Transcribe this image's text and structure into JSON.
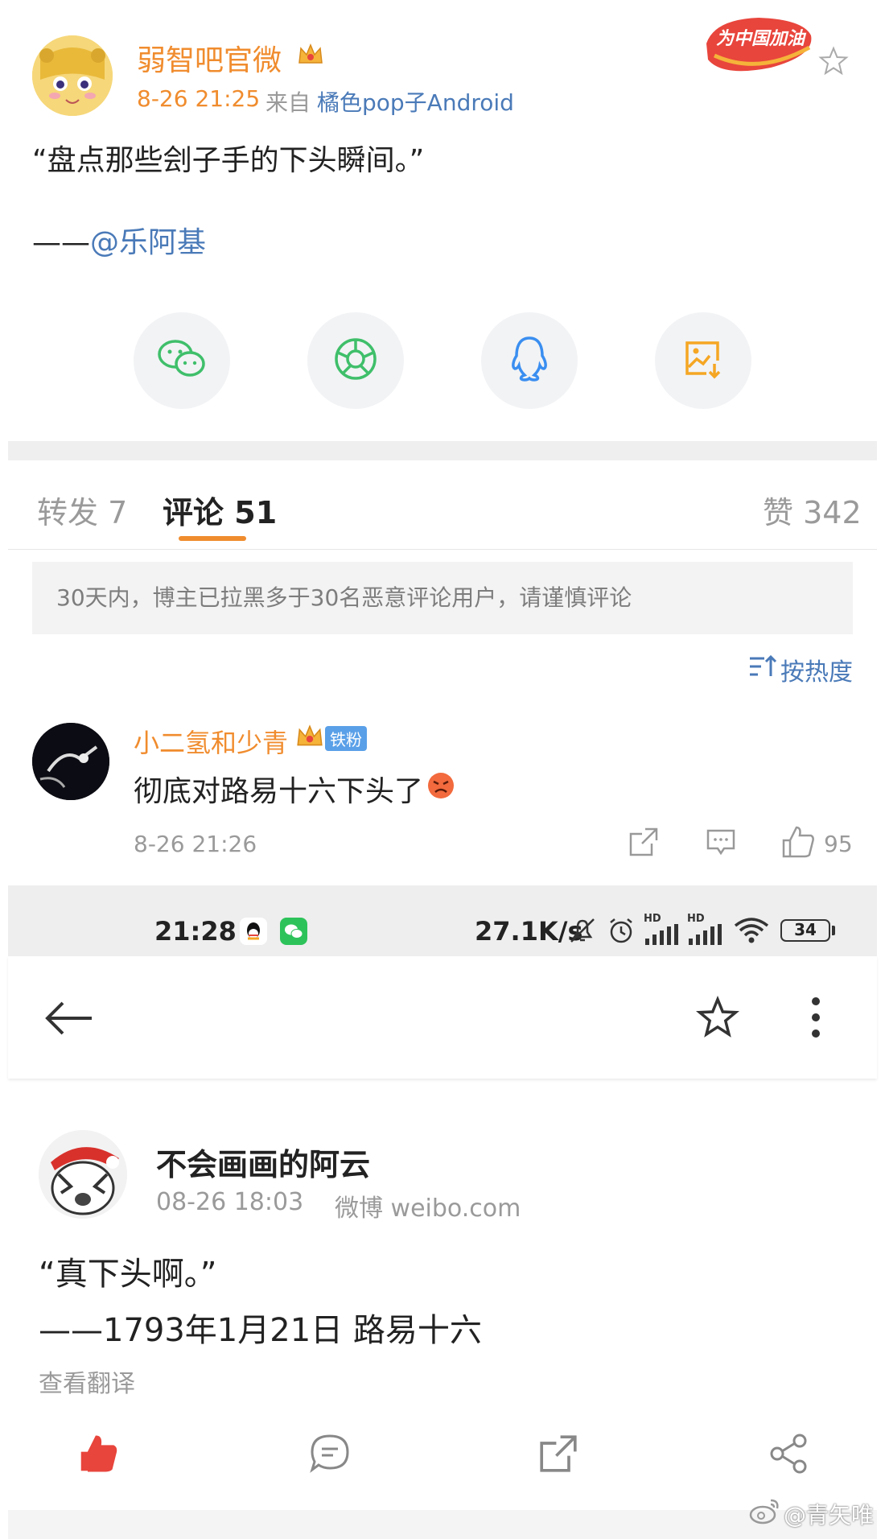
{
  "post": {
    "username": "弱智吧官微",
    "time": "8-26 21:25",
    "source_prefix": "来自",
    "source": "橘色pop子Android",
    "content_line1": "“盘点那些刽子手的下头瞬间。”",
    "content_line2_prefix": "——",
    "content_line2_mention": "@乐阿基",
    "badge_text": "为中国加油"
  },
  "share_buttons": [
    {
      "name": "wechat",
      "icon": "wechat-icon"
    },
    {
      "name": "moments",
      "icon": "moments-icon"
    },
    {
      "name": "qq",
      "icon": "qq-icon"
    },
    {
      "name": "save-image",
      "icon": "image-download-icon"
    }
  ],
  "tabs": {
    "repost_label": "转发",
    "repost_count": "7",
    "comment_label": "评论",
    "comment_count": "51",
    "like_label": "赞",
    "like_count": "342"
  },
  "notice": "30天内，博主已拉黑多于30名恶意评论用户，请谨慎评论",
  "sort_label": "按热度",
  "comment": {
    "username": "小二氢和少青",
    "fan_badge": "铁粉",
    "text": "彻底对路易十六下头了",
    "time": "8-26 21:26",
    "likes": "95"
  },
  "status_bar": {
    "time": "21:28",
    "speed": "27.1K/s",
    "battery": "34",
    "hd1": "HD",
    "hd2": "HD"
  },
  "second_post": {
    "username": "不会画画的阿云",
    "time": "08-26 18:03",
    "source": "微博 weibo.com",
    "line1": "“真下头啊。”",
    "line2": "——1793年1月21日 路易十六",
    "translate": "查看翻译"
  },
  "watermark": "@青矢唯",
  "colors": {
    "accent": "#f08c2e",
    "like_red": "#e8453c",
    "link_blue": "#4a7ab8"
  }
}
